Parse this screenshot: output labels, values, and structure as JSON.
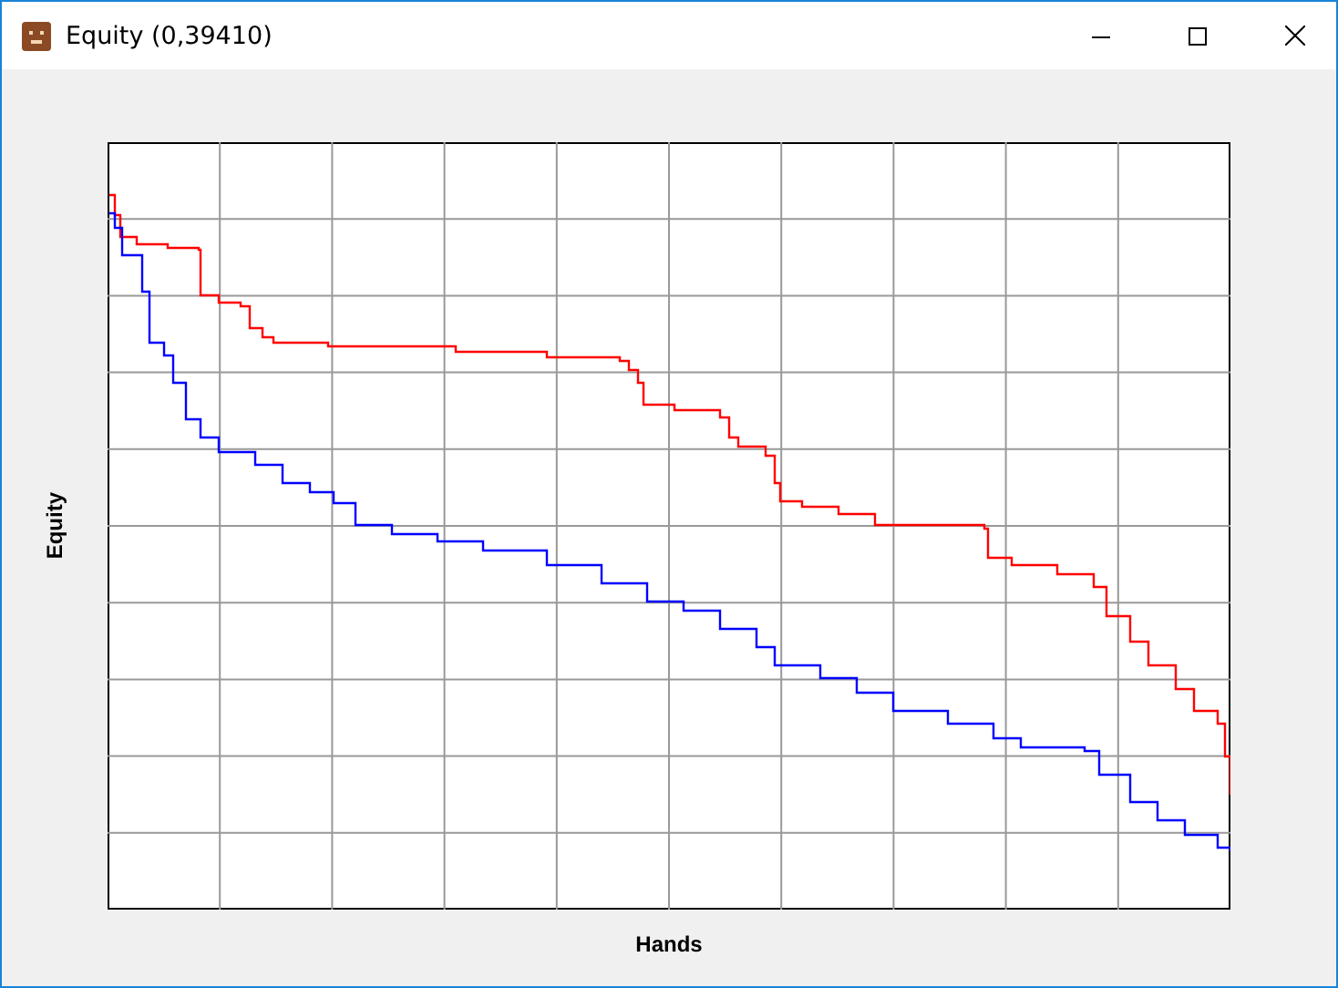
{
  "window": {
    "title": "Equity (0,39410)"
  },
  "chart": {
    "ylabel": "Equity",
    "xlabel": "Hands"
  }
}
